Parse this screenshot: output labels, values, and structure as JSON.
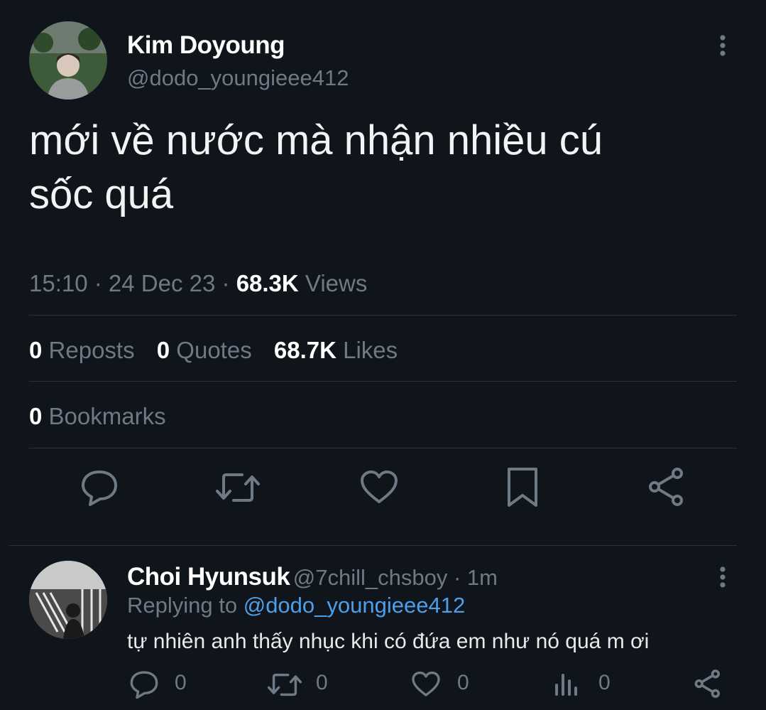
{
  "tweet": {
    "author_name": "Kim Doyoung",
    "author_handle": "@dodo_youngieee412",
    "text_line1": "mới về nước mà nhận nhiều cú",
    "text_line2": "sốc quá",
    "time": "15:10",
    "sep1": " · ",
    "date": "24 Dec 23",
    "sep2": " · ",
    "views_count": "68.3K",
    "views_label": "Views",
    "reposts_count": "0",
    "reposts_label": "Reposts",
    "quotes_count": "0",
    "quotes_label": "Quotes",
    "likes_count": "68.7K",
    "likes_label": "Likes",
    "bookmarks_count": "0",
    "bookmarks_label": "Bookmarks"
  },
  "reply": {
    "author_name": "Choi Hyunsuk",
    "author_handle": "@7chill_chsboy",
    "sep": " · ",
    "time": "1m",
    "replying_prefix": "Replying to ",
    "replying_handle": "@dodo_youngieee412",
    "text": "tự nhiên anh thấy nhục khi có đứa em như nó quá m ơi",
    "reply_count": "0",
    "repost_count": "0",
    "like_count": "0",
    "views_count": "0"
  },
  "icons": {
    "more": "more-vertical-icon",
    "reply": "reply-icon",
    "repost": "repost-icon",
    "like": "heart-icon",
    "bookmark": "bookmark-icon",
    "share": "share-icon",
    "views": "views-icon"
  },
  "colors": {
    "background": "#10141b",
    "text": "#e7e9ea",
    "muted": "#6e7a86",
    "link": "#4f9ee8",
    "divider": "#2a3139"
  }
}
